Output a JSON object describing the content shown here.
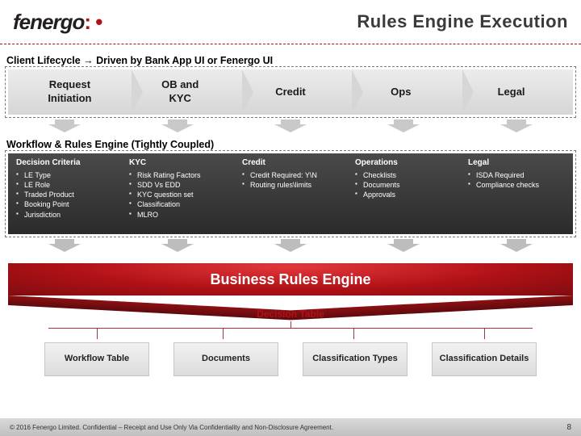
{
  "header": {
    "logo_text": "fenergo",
    "logo_punct": ": •",
    "title": "Rules Engine Execution"
  },
  "section1": {
    "label": "Client Lifecycle → Driven by Bank App UI or Fenergo UI",
    "stages": {
      "s0a": "Request",
      "s0b": "Initiation",
      "s1a": "OB and",
      "s1b": "KYC",
      "s2": "Credit",
      "s3": "Ops",
      "s4": "Legal"
    }
  },
  "section2": {
    "label": "Workflow & Rules Engine (Tightly Coupled)",
    "cols": {
      "c0": {
        "h": "Decision Criteria",
        "i0": "LE Type",
        "i1": "LE Role",
        "i2": "Traded Product",
        "i3": "Booking Point",
        "i4": "Jurisdiction"
      },
      "c1": {
        "h": "KYC",
        "i0": "Risk Rating Factors",
        "i1": "SDD Vs EDD",
        "i2": "KYC question set",
        "i3": "Classification",
        "i4": "MLRO"
      },
      "c2": {
        "h": "Credit",
        "i0": "Credit Required: Y\\N",
        "i1": "Routing rules\\limits"
      },
      "c3": {
        "h": "Operations",
        "i0": "Checklists",
        "i1": "Documents",
        "i2": "Approvals"
      },
      "c4": {
        "h": "Legal",
        "i0": "ISDA Required",
        "i1": "Compliance checks"
      }
    }
  },
  "engine": {
    "banner": "Business Rules Engine",
    "decision_table": "Decision Table",
    "chips": {
      "c0": "Workflow Table",
      "c1": "Documents",
      "c2": "Classification Types",
      "c3": "Classification Details"
    }
  },
  "footer": {
    "copyright": "© 2016 Fenergo Limited. Confidential – Receipt and Use Only Via Confidentiality and Non-Disclosure Agreement.",
    "page": "8"
  }
}
